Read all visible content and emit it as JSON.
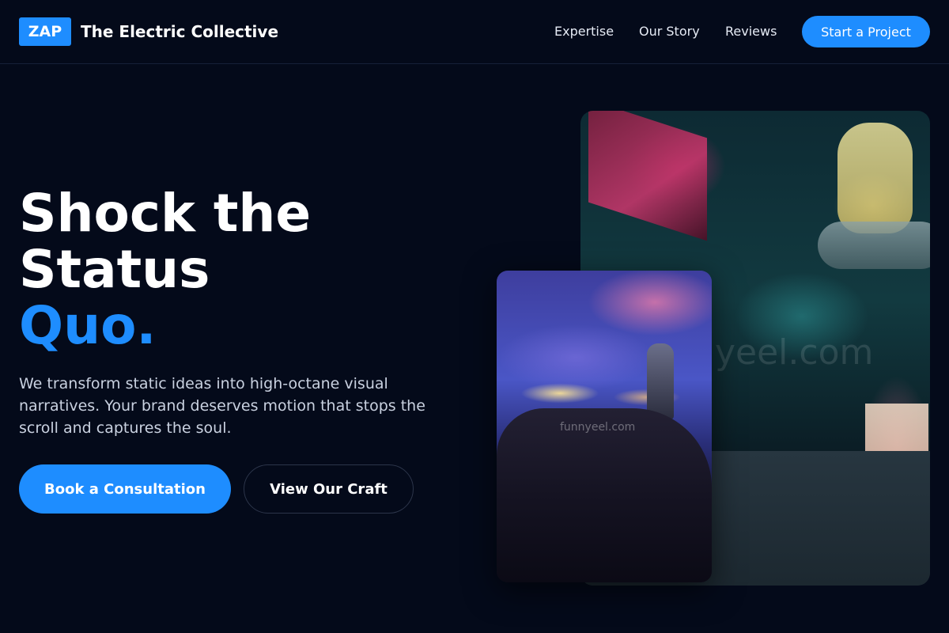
{
  "nav": {
    "logo_badge": "ZAP",
    "brand_name": "The Electric Collective",
    "links": [
      "Expertise",
      "Our Story",
      "Reviews"
    ],
    "cta": "Start a Project"
  },
  "hero": {
    "title_line1": "Shock the",
    "title_line2": "Status",
    "title_accent": "Quo.",
    "subtitle": "We transform static ideas into high-octane visual narratives. Your brand deserves motion that stops the scroll and captures the soul.",
    "primary_button": "Book a Consultation",
    "secondary_button": "View Our Craft"
  },
  "media": {
    "watermark_small": "funnyeel.com",
    "watermark_large": "yeel.com"
  },
  "colors": {
    "background": "#040a1a",
    "accent": "#1e8dff",
    "text": "#ffffff",
    "muted_text": "#c9d1e0"
  }
}
